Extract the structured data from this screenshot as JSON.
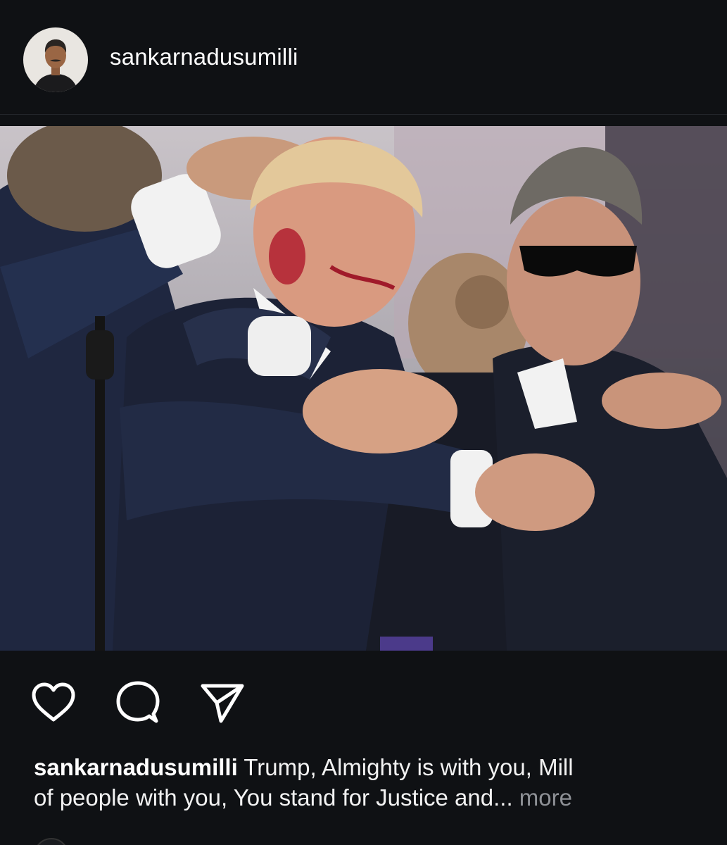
{
  "post": {
    "username": "sankarnadusumilli",
    "image_alt": "Photo post",
    "actions": {
      "like": "heart-icon",
      "comment": "comment-icon",
      "share": "send-icon"
    },
    "caption": {
      "username": "sankarnadusumilli",
      "line1": " Trump, Almighty is with you, Mill",
      "line2": "of people with you, You stand for Justice and... ",
      "more_label": "more"
    }
  },
  "colors": {
    "background": "#0f1114",
    "text": "#ffffff",
    "muted": "#8e9196"
  }
}
